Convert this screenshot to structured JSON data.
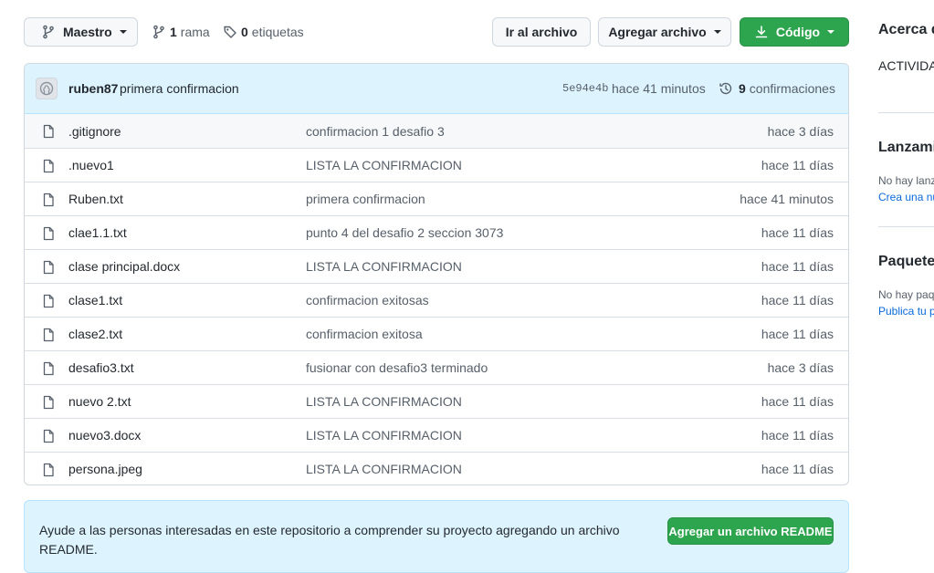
{
  "toolbar": {
    "branch_label": "Maestro",
    "branches_count": "1",
    "branches_label": "rama",
    "tags_count": "0",
    "tags_label": "etiquetas",
    "goto_file_label": "Ir al archivo",
    "add_file_label": "Agregar archivo",
    "code_label": "Código"
  },
  "commit": {
    "author": "ruben87",
    "message": "primera confirmacion",
    "sha": "5e94e4b",
    "time": "hace 41 minutos",
    "count": "9",
    "count_label": "confirmaciones"
  },
  "files": [
    {
      "name": ".gitignore",
      "message": "confirmacion 1 desafio 3",
      "age": "hace 3 días"
    },
    {
      "name": ".nuevo1",
      "message": "LISTA LA CONFIRMACION",
      "age": "hace 11 días"
    },
    {
      "name": "Ruben.txt",
      "message": "primera confirmacion",
      "age": "hace 41 minutos"
    },
    {
      "name": "clae1.1.txt",
      "message": "punto 4 del desafio 2 seccion 3073",
      "age": "hace 11 días"
    },
    {
      "name": "clase principal.docx",
      "message": "LISTA LA CONFIRMACION",
      "age": "hace 11 días"
    },
    {
      "name": "clase1.txt",
      "message": "confirmacion exitosas",
      "age": "hace 11 días"
    },
    {
      "name": "clase2.txt",
      "message": "confirmacion exitosa",
      "age": "hace 11 días"
    },
    {
      "name": "desafio3.txt",
      "message": "fusionar con desafio3 terminado",
      "age": "hace 3 días"
    },
    {
      "name": "nuevo 2.txt",
      "message": "LISTA LA CONFIRMACION",
      "age": "hace 11 días"
    },
    {
      "name": "nuevo3.docx",
      "message": "LISTA LA CONFIRMACION",
      "age": "hace 11 días"
    },
    {
      "name": "persona.jpeg",
      "message": "LISTA LA CONFIRMACION",
      "age": "hace 11 días"
    }
  ],
  "readme": {
    "text": "Ayude a las personas interesadas en este repositorio a comprender su proyecto agregando un archivo README.",
    "button_label": "Agregar un archivo README"
  },
  "sidebar": {
    "about_heading": "Acerca d",
    "about_text": "ACTIVIDA",
    "releases_heading": "Lanzamie",
    "releases_text": "No hay lanz",
    "releases_link": "Crea una nu",
    "packages_heading": "Paquetes",
    "packages_text": "No hay paq",
    "packages_link": "Publica tu p"
  },
  "colors": {
    "accent_green": "#2da44e",
    "link_blue": "#0969da",
    "commit_bg": "#ddf4ff"
  }
}
